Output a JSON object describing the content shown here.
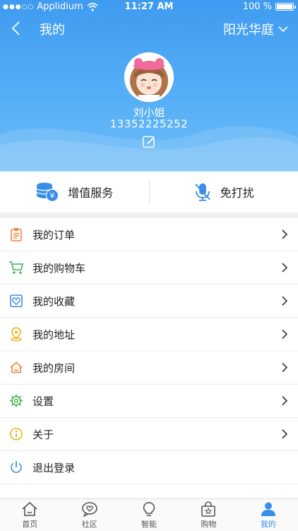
{
  "status_bar": {
    "carrier": "Applidium",
    "time": "11:27 AM",
    "battery": "100 %"
  },
  "nav": {
    "title": "我的",
    "community": "阳光华庭"
  },
  "profile": {
    "name": "刘小姐",
    "phone": "13352225252"
  },
  "quick_actions": [
    {
      "label": "增值服务",
      "icon": "coins-icon"
    },
    {
      "label": "免打扰",
      "icon": "mute-mic-icon"
    }
  ],
  "menu": [
    {
      "label": "我的订单",
      "icon": "order-icon",
      "color": "#f0843c"
    },
    {
      "label": "我的购物车",
      "icon": "cart-icon",
      "color": "#3cb34a"
    },
    {
      "label": "我的收藏",
      "icon": "favorite-icon",
      "color": "#3a8ee6"
    },
    {
      "label": "我的地址",
      "icon": "location-icon",
      "color": "#e8b21a"
    },
    {
      "label": "我的房间",
      "icon": "house-icon",
      "color": "#f0843c"
    },
    {
      "label": "设置",
      "icon": "gear-icon",
      "color": "#3cb34a"
    },
    {
      "label": "关于",
      "icon": "info-icon",
      "color": "#e8b21a"
    },
    {
      "label": "退出登录",
      "icon": "power-icon",
      "color": "#3a8ee6"
    }
  ],
  "tabs": [
    {
      "label": "首页",
      "icon": "home-icon"
    },
    {
      "label": "社区",
      "icon": "community-icon"
    },
    {
      "label": "智能",
      "icon": "bulb-icon"
    },
    {
      "label": "购物",
      "icon": "shopping-bag-icon"
    },
    {
      "label": "我的",
      "icon": "user-icon",
      "active": true
    }
  ],
  "colors": {
    "accent": "#3a8ee6",
    "header": "#4aa5f3"
  }
}
